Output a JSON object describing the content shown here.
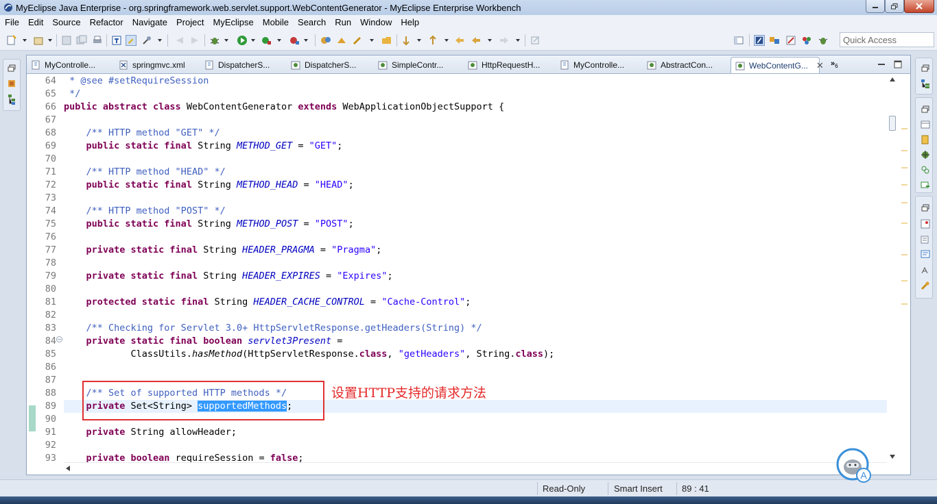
{
  "window": {
    "title": "MyEclipse Java Enterprise - org.springframework.web.servlet.support.WebContentGenerator - MyEclipse Enterprise Workbench"
  },
  "menu": [
    "File",
    "Edit",
    "Source",
    "Refactor",
    "Navigate",
    "Project",
    "MyEclipse",
    "Mobile",
    "Search",
    "Run",
    "Window",
    "Help"
  ],
  "quick_access": {
    "placeholder": "Quick Access"
  },
  "tabs": [
    {
      "label": "MyControlle...",
      "icon": "java-class-icon"
    },
    {
      "label": "springmvc.xml",
      "icon": "xml-file-icon"
    },
    {
      "label": "DispatcherS...",
      "icon": "java-class-icon"
    },
    {
      "label": "DispatcherS...",
      "icon": "class-file-icon"
    },
    {
      "label": "SimpleContr...",
      "icon": "class-file-icon"
    },
    {
      "label": "HttpRequestH...",
      "icon": "class-file-icon"
    },
    {
      "label": "MyControlle...",
      "icon": "java-class-icon"
    },
    {
      "label": "AbstractCon...",
      "icon": "class-file-icon"
    },
    {
      "label": "WebContentG...",
      "icon": "class-file-icon",
      "active": true
    }
  ],
  "overflow_count": "6",
  "code_lines": [
    {
      "n": "64",
      "tokens": [
        [
          "cm",
          " * @see #setRequireSession"
        ]
      ]
    },
    {
      "n": "65",
      "tokens": [
        [
          "cm",
          " */"
        ]
      ]
    },
    {
      "n": "66",
      "tokens": [
        [
          "kw",
          "public abstract class"
        ],
        [
          "",
          " WebContentGenerator "
        ],
        [
          "kw",
          "extends"
        ],
        [
          "",
          " WebApplicationObjectSupport {"
        ]
      ]
    },
    {
      "n": "67",
      "tokens": []
    },
    {
      "n": "68",
      "tokens": [
        [
          "",
          "    "
        ],
        [
          "cm",
          "/** HTTP method \"GET\" */"
        ]
      ]
    },
    {
      "n": "69",
      "tokens": [
        [
          "",
          "    "
        ],
        [
          "kw",
          "public static final"
        ],
        [
          "",
          " String "
        ],
        [
          "fi",
          "METHOD_GET"
        ],
        [
          "",
          " = "
        ],
        [
          "st",
          "\"GET\""
        ],
        [
          "",
          ";"
        ]
      ]
    },
    {
      "n": "70",
      "tokens": []
    },
    {
      "n": "71",
      "tokens": [
        [
          "",
          "    "
        ],
        [
          "cm",
          "/** HTTP method \"HEAD\" */"
        ]
      ]
    },
    {
      "n": "72",
      "tokens": [
        [
          "",
          "    "
        ],
        [
          "kw",
          "public static final"
        ],
        [
          "",
          " String "
        ],
        [
          "fi",
          "METHOD_HEAD"
        ],
        [
          "",
          " = "
        ],
        [
          "st",
          "\"HEAD\""
        ],
        [
          "",
          ";"
        ]
      ]
    },
    {
      "n": "73",
      "tokens": []
    },
    {
      "n": "74",
      "tokens": [
        [
          "",
          "    "
        ],
        [
          "cm",
          "/** HTTP method \"POST\" */"
        ]
      ]
    },
    {
      "n": "75",
      "tokens": [
        [
          "",
          "    "
        ],
        [
          "kw",
          "public static final"
        ],
        [
          "",
          " String "
        ],
        [
          "fi",
          "METHOD_POST"
        ],
        [
          "",
          " = "
        ],
        [
          "st",
          "\"POST\""
        ],
        [
          "",
          ";"
        ]
      ]
    },
    {
      "n": "76",
      "tokens": []
    },
    {
      "n": "77",
      "tokens": [
        [
          "",
          "    "
        ],
        [
          "kw",
          "private static final"
        ],
        [
          "",
          " String "
        ],
        [
          "fi",
          "HEADER_PRAGMA"
        ],
        [
          "",
          " = "
        ],
        [
          "st",
          "\"Pragma\""
        ],
        [
          "",
          ";"
        ]
      ]
    },
    {
      "n": "78",
      "tokens": []
    },
    {
      "n": "79",
      "tokens": [
        [
          "",
          "    "
        ],
        [
          "kw",
          "private static final"
        ],
        [
          "",
          " String "
        ],
        [
          "fi",
          "HEADER_EXPIRES"
        ],
        [
          "",
          " = "
        ],
        [
          "st",
          "\"Expires\""
        ],
        [
          "",
          ";"
        ]
      ]
    },
    {
      "n": "80",
      "tokens": []
    },
    {
      "n": "81",
      "tokens": [
        [
          "",
          "    "
        ],
        [
          "kw",
          "protected static final"
        ],
        [
          "",
          " String "
        ],
        [
          "fi",
          "HEADER_CACHE_CONTROL"
        ],
        [
          "",
          " = "
        ],
        [
          "st",
          "\"Cache-Control\""
        ],
        [
          "",
          ";"
        ]
      ]
    },
    {
      "n": "82",
      "tokens": []
    },
    {
      "n": "83",
      "tokens": [
        [
          "",
          "    "
        ],
        [
          "cm",
          "/** Checking for Servlet 3.0+ HttpServletResponse.getHeaders(String) */"
        ]
      ]
    },
    {
      "n": "84",
      "tokens": [
        [
          "",
          "    "
        ],
        [
          "kw",
          "private static final boolean"
        ],
        [
          "",
          " "
        ],
        [
          "fi",
          "servlet3Present"
        ],
        [
          "",
          " ="
        ]
      ]
    },
    {
      "n": "85",
      "tokens": [
        [
          "",
          "            ClassUtils."
        ],
        [
          "sm",
          "hasMethod"
        ],
        [
          "",
          "(HttpServletResponse."
        ],
        [
          "kw",
          "class"
        ],
        [
          "",
          ", "
        ],
        [
          "st",
          "\"getHeaders\""
        ],
        [
          "",
          ", String."
        ],
        [
          "kw",
          "class"
        ],
        [
          "",
          ");"
        ]
      ]
    },
    {
      "n": "86",
      "tokens": []
    },
    {
      "n": "87",
      "tokens": []
    },
    {
      "n": "88",
      "tokens": [
        [
          "",
          "    "
        ],
        [
          "cm",
          "/** Set of supported HTTP methods */"
        ]
      ]
    },
    {
      "n": "89",
      "tokens": [
        [
          "",
          "    "
        ],
        [
          "kw",
          "private"
        ],
        [
          "",
          " Set<String> "
        ],
        [
          "sel",
          "supportedMethods"
        ],
        [
          "",
          ";"
        ]
      ]
    },
    {
      "n": "90",
      "tokens": []
    },
    {
      "n": "91",
      "tokens": [
        [
          "",
          "    "
        ],
        [
          "kw",
          "private"
        ],
        [
          "",
          " String allowHeader;"
        ]
      ]
    },
    {
      "n": "92",
      "tokens": []
    },
    {
      "n": "93",
      "tokens": [
        [
          "",
          "    "
        ],
        [
          "kw",
          "private boolean"
        ],
        [
          "",
          " requireSession = "
        ],
        [
          "kw",
          "false"
        ],
        [
          "",
          ";"
        ]
      ]
    }
  ],
  "annotation": "设置HTTP支持的请求方法",
  "status": {
    "mode": "Read-Only",
    "insert": "Smart Insert",
    "position": "89 : 41"
  },
  "colors": {
    "keyword": "#7f0055",
    "comment": "#3f5fbf",
    "string": "#2a00ff",
    "field": "#0000c0",
    "selection": "#3399ff",
    "annotation": "#e52a2a"
  }
}
